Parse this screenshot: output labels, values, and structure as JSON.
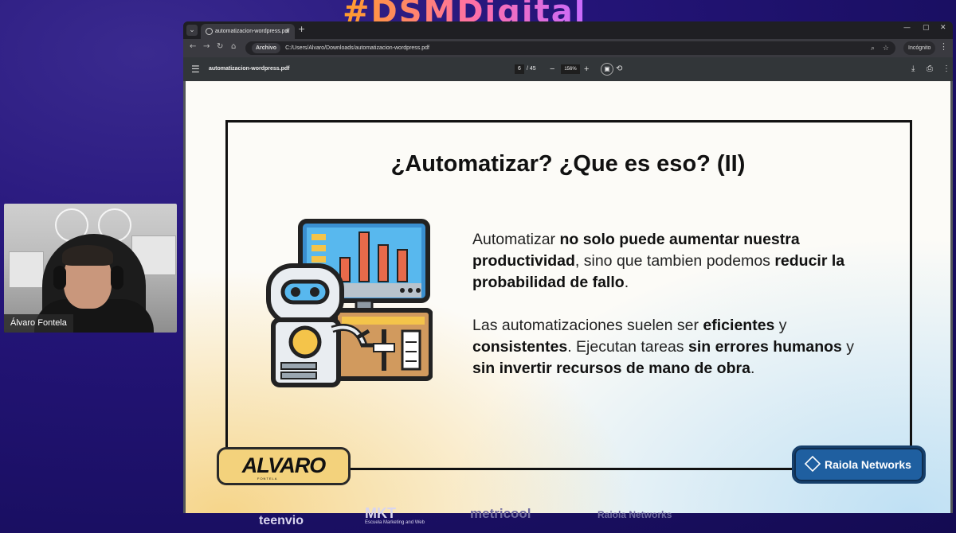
{
  "event": {
    "banner": "#DSMDigital"
  },
  "sponsors": [
    "teenvio",
    "MKT",
    "Escuela Marketing and Web",
    "metricool",
    "Raiola Networks"
  ],
  "webcam": {
    "presenter_name": "Álvaro Fontela"
  },
  "browser": {
    "tab_title": "automatizacion-wordpress.pdf",
    "chip": "Archivo",
    "url": "C:/Users/Alvaro/Downloads/automatizacion-wordpress.pdf",
    "incognito_label": "Incógnito"
  },
  "pdf_toolbar": {
    "title": "automatizacion-wordpress.pdf",
    "current_page": "6",
    "total_pages": "/ 45",
    "zoom": "156%"
  },
  "slide": {
    "title": "¿Automatizar? ¿Que es eso? (II)",
    "paragraph1": {
      "t1": "Automatizar ",
      "b1": "no solo puede aumentar nuestra productividad",
      "t2": ", sino que tambien podemos ",
      "b2": "reducir la probabilidad de fallo",
      "t3": "."
    },
    "paragraph2": {
      "t1": "Las automatizaciones suelen ser ",
      "b1": "eficientes",
      "t2": " y ",
      "b2": "consistentes",
      "t3": ". Ejecutan tareas ",
      "b3": "sin errores humanos",
      "t4": " y ",
      "b4": "sin invertir recursos de mano de obra",
      "t5": "."
    },
    "badge_left": {
      "logo": "ALVARO",
      "sub": "FONTELA"
    },
    "badge_right": {
      "label": "Raiola Networks"
    }
  }
}
